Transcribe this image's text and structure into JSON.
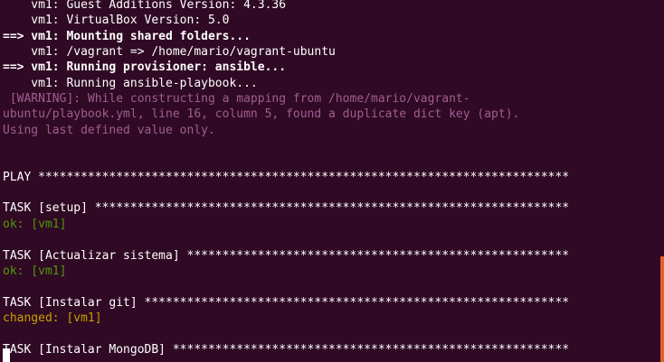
{
  "terminal": {
    "colors": {
      "background": "#300a24",
      "text": "#ffffff",
      "warning": "#a05d92",
      "ok": "#4e9a06",
      "changed": "#c4a000",
      "scrollbar": "#e0622b"
    },
    "lines": [
      {
        "text": "    vm1: Guest Additions Version: 4.3.36",
        "style": "normal"
      },
      {
        "text": "    vm1: VirtualBox Version: 5.0",
        "style": "normal"
      },
      {
        "text": "==> vm1: Mounting shared folders...",
        "style": "bold"
      },
      {
        "text": "    vm1: /vagrant => /home/mario/vagrant-ubuntu",
        "style": "normal"
      },
      {
        "text": "==> vm1: Running provisioner: ansible...",
        "style": "bold"
      },
      {
        "text": "    vm1: Running ansible-playbook...",
        "style": "normal"
      },
      {
        "text": " [WARNING]: While constructing a mapping from /home/mario/vagrant-",
        "style": "warning"
      },
      {
        "text": "ubuntu/playbook.yml, line 16, column 5, found a duplicate dict key (apt).",
        "style": "warning"
      },
      {
        "text": "Using last defined value only.",
        "style": "warning"
      },
      {
        "text": "",
        "style": "normal"
      },
      {
        "text": "",
        "style": "normal"
      },
      {
        "text": "PLAY ***************************************************************************",
        "style": "normal"
      },
      {
        "text": "",
        "style": "normal"
      },
      {
        "text": "TASK [setup] *******************************************************************",
        "style": "normal"
      },
      {
        "text": "ok: [vm1]",
        "style": "ok"
      },
      {
        "text": "",
        "style": "normal"
      },
      {
        "text": "TASK [Actualizar sistema] ******************************************************",
        "style": "normal"
      },
      {
        "text": "ok: [vm1]",
        "style": "ok"
      },
      {
        "text": "",
        "style": "normal"
      },
      {
        "text": "TASK [Instalar git] ************************************************************",
        "style": "normal"
      },
      {
        "text": "changed: [vm1]",
        "style": "changed"
      },
      {
        "text": "",
        "style": "normal"
      },
      {
        "text": "TASK [Instalar MongoDB] ********************************************************",
        "style": "normal"
      }
    ]
  }
}
